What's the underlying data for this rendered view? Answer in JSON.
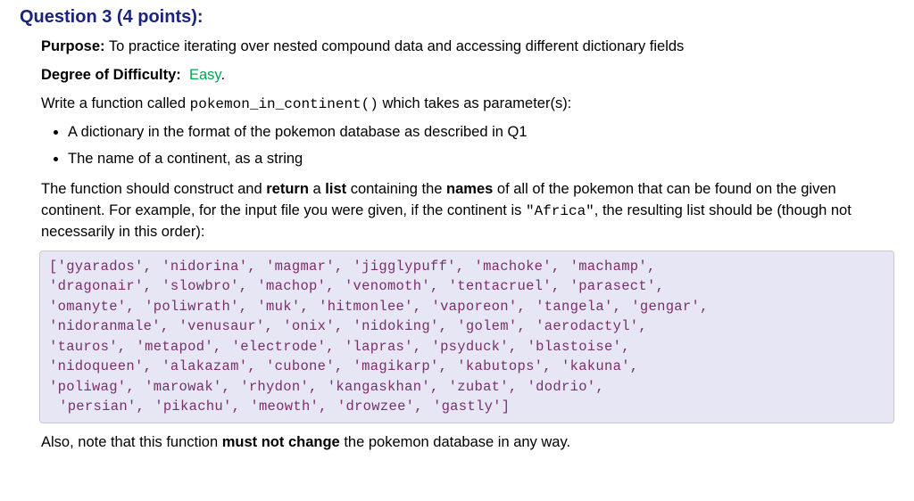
{
  "title": "Question 3 (4 points):",
  "purpose": {
    "label": "Purpose:",
    "text": "To practice iterating over nested compound data and accessing different dictionary fields"
  },
  "difficulty": {
    "label": "Degree of Difficulty:",
    "value": "Easy"
  },
  "intro": {
    "prefix": "Write a function called ",
    "code": "pokemon_in_continent()",
    "suffix": " which takes as parameter(s):"
  },
  "bullets": [
    "A dictionary in the format of the pokemon database as described in Q1",
    "The name of a continent, as a string"
  ],
  "body": {
    "p1a": "The function should construct and ",
    "p1b": "return",
    "p1c": " a ",
    "p1d": "list",
    "p1e": " containing the ",
    "p1f": "names",
    "p1g": " of all of the pokemon that can be found on the given continent. For example, for the input file you were given, if the continent is ",
    "p1code": "\"Africa\"",
    "p1h": ", the resulting list should be (though not necessarily in this order):"
  },
  "codebox": "['gyarados', 'nidorina', 'magmar', 'jigglypuff', 'machoke', 'machamp',\n'dragonair', 'slowbro', 'machop', 'venomoth', 'tentacruel', 'parasect',\n'omanyte', 'poliwrath', 'muk', 'hitmonlee', 'vaporeon', 'tangela', 'gengar',\n'nidoranmale', 'venusaur', 'onix', 'nidoking', 'golem', 'aerodactyl',\n'tauros', 'metapod', 'electrode', 'lapras', 'psyduck', 'blastoise',\n'nidoqueen', 'alakazam', 'cubone', 'magikarp', 'kabutops', 'kakuna',\n'poliwag', 'marowak', 'rhydon', 'kangaskhan', 'zubat', 'dodrio',\n 'persian', 'pikachu', 'meowth', 'drowzee', 'gastly']",
  "closing": {
    "a": "Also, note that this function ",
    "b": "must not change",
    "c": " the pokemon database in any way."
  }
}
